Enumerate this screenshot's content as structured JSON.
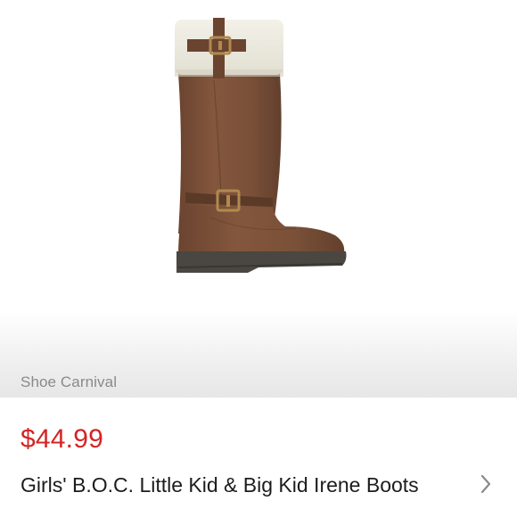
{
  "seller": {
    "name": "Shoe Carnival"
  },
  "product": {
    "price": "$44.99",
    "title": "Girls' B.O.C. Little Kid & Big Kid Irene Boots",
    "image_alt": "boot-photo"
  },
  "colors": {
    "price": "#d32424",
    "seller_text": "#8a8a8a",
    "title_text": "#1c1c1c",
    "boot_leather": "#7a5038",
    "boot_sole": "#4a4642",
    "cuff_fleece": "#ece9dd"
  },
  "icons": {
    "disclosure": "chevron-right-icon"
  }
}
